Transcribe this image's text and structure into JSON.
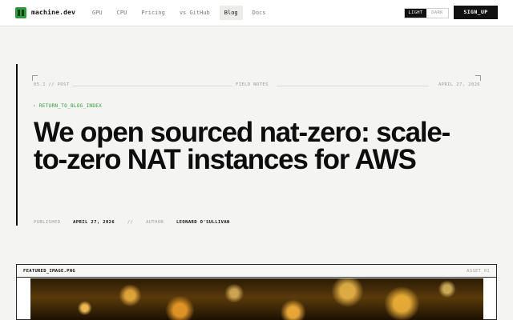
{
  "header": {
    "brand": "machine.dev",
    "nav": [
      "GPU",
      "CPU",
      "Pricing",
      "vs GitHub",
      "Blog",
      "Docs"
    ],
    "active_nav": "Blog",
    "theme_light": "LIGHT",
    "theme_dark": "DARK",
    "signup": "SIGN_UP"
  },
  "article": {
    "section": "05.1 // POST",
    "category": "FIELD NOTES",
    "date_top": "APRIL 27, 2026",
    "back_link": "‹ RETURN_TO_BLOG_INDEX",
    "title": "We open sourced nat-zero: scale-to-zero NAT instances for AWS",
    "published_label": "PUBLISHED",
    "published_date": "APRIL 27, 2026",
    "separator": "//",
    "author_label": "AUTHOR",
    "author_name": "LEONARD O'SULLIVAN"
  },
  "featured": {
    "filename": "FEATURED_IMAGE.PNG",
    "asset_id": "ASSET_01"
  },
  "colors": {
    "accent_green": "#2f9a3a",
    "text": "#111111",
    "background": "#f4f4f2"
  },
  "icons": [
    "machine-logo-icon",
    "corner-bracket-icon"
  ]
}
